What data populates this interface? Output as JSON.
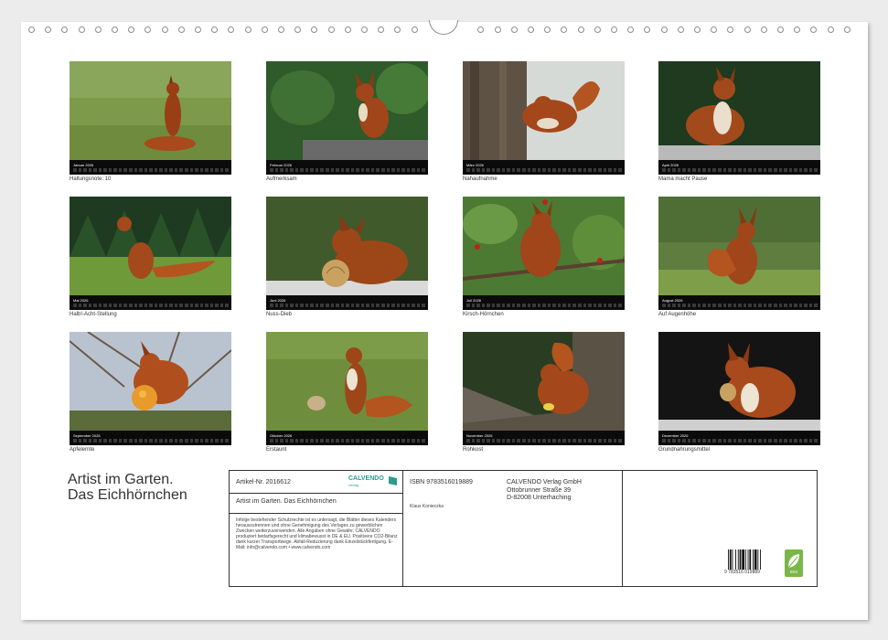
{
  "months": [
    {
      "label": "Januar 2026",
      "caption": "Haltungsnote: 10"
    },
    {
      "label": "Februar 2026",
      "caption": "Aufmerksam"
    },
    {
      "label": "März 2026",
      "caption": "Nahaufnahme"
    },
    {
      "label": "April 2026",
      "caption": "Mama macht Pause"
    },
    {
      "label": "Mai 2026",
      "caption": "Halb!-Acht-Stellung"
    },
    {
      "label": "Juni 2026",
      "caption": "Nuss-Dieb"
    },
    {
      "label": "Juli 2026",
      "caption": "Kirsch-Hörnchen"
    },
    {
      "label": "August 2026",
      "caption": "Auf Augenhöhe"
    },
    {
      "label": "September 2026",
      "caption": "Apfelernte"
    },
    {
      "label": "Oktober 2026",
      "caption": "Erstaunt"
    },
    {
      "label": "November 2026",
      "caption": "Rohkost"
    },
    {
      "label": "Dezember 2026",
      "caption": "Grundnahrungsmittel"
    }
  ],
  "title": {
    "line1": "Artist im Garten.",
    "line2": "Das Eichhörnchen"
  },
  "info": {
    "article": "Artikel-Nr. 2016612",
    "publisher_logo": "CALVENDO",
    "publisher_tagline": "Verlag",
    "calendar_title": "Artist im Garten. Das Eichhörnchen",
    "legal": "Infolge bestehender Schutzrechte ist es untersagt, die Blätter dieses Kalenders herauszutrennen und ohne Genehmigung des Verlages zu gewerblichen Zwecken weiterzuverwenden. Alle Angaben ohne Gewähr. CALVENDO produziert bedarfsgerecht und klimabewusst in DE & EU. Positivere CO2-Bilanz dank kurzer Transportwege. Abfall-Reduzierung dank Einzelstückfertigung. E-Mail: info@calvendo.com • www.calvendo.com",
    "isbn": "ISBN 9783516019889",
    "author": "Klaus Konieczka",
    "publisher_name": "CALVENDO Verlag GmbH",
    "publisher_street": "Ottobrunner Straße 39",
    "publisher_city": "D-82008 Unterhaching",
    "barcode_number": "9 783516 019889",
    "eco_label": "eco"
  },
  "colors": {
    "accent": "#2a9d8f",
    "eco": "#7ab648",
    "strip": "#0b0b0b"
  }
}
